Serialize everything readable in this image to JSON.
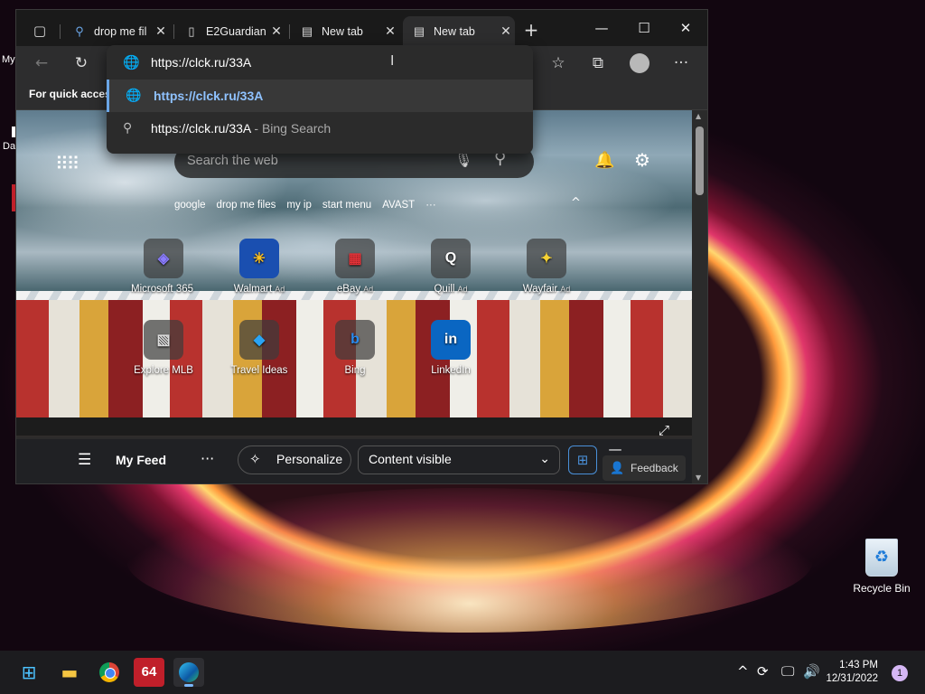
{
  "desktop": {
    "left_fragments": [
      "My",
      "Da"
    ],
    "recycle_bin": {
      "label": "Recycle Bin",
      "icon": "recycle-bin-icon"
    }
  },
  "browser": {
    "tabs": [
      {
        "title": "drop me fil",
        "icon": "search-icon",
        "active": false
      },
      {
        "title": "E2Guardian",
        "icon": "document-icon",
        "active": false
      },
      {
        "title": "New tab",
        "icon": "new-tab-icon",
        "active": false
      },
      {
        "title": "New tab",
        "icon": "new-tab-icon",
        "active": true
      }
    ],
    "favorites_bar_text": "For quick access",
    "omnibox": {
      "value": "https://clck.ru/33A",
      "suggestions": [
        {
          "text": "https://clck.ru/33A",
          "hint": "",
          "icon": "globe-icon",
          "selected": true
        },
        {
          "text": "https://clck.ru/33A",
          "hint": " - Bing Search",
          "icon": "search-icon",
          "selected": false
        }
      ]
    },
    "ntp": {
      "search_placeholder": "Search the web",
      "quick_links": [
        "google",
        "drop me files",
        "my ip",
        "start menu",
        "AVAST",
        "···"
      ],
      "tiles": [
        {
          "label": "Microsoft 365",
          "ad": "",
          "icon": "microsoft-365-icon"
        },
        {
          "label": "Walmart",
          "ad": "Ad",
          "icon": "walmart-icon"
        },
        {
          "label": "eBay",
          "ad": "Ad",
          "icon": "ebay-icon"
        },
        {
          "label": "Quill",
          "ad": "Ad",
          "icon": "quill-icon"
        },
        {
          "label": "Wayfair",
          "ad": "Ad",
          "icon": "wayfair-icon"
        },
        {
          "label": "Explore MLB",
          "ad": "",
          "icon": "mlb-icon"
        },
        {
          "label": "Travel Ideas",
          "ad": "",
          "icon": "travel-icon"
        },
        {
          "label": "Bing",
          "ad": "",
          "icon": "bing-icon"
        },
        {
          "label": "LinkedIn",
          "ad": "",
          "icon": "linkedin-icon"
        }
      ],
      "feed_bar": {
        "title": "My Feed",
        "personalize": "Personalize",
        "content_visible": "Content visible",
        "feedback": "Feedback"
      }
    }
  },
  "taskbar": {
    "time": "1:43 PM",
    "date": "12/31/2022",
    "notifications": "1",
    "apps": [
      "start-icon",
      "file-explorer-icon",
      "chrome-icon",
      "aida64-icon",
      "edge-icon"
    ]
  }
}
